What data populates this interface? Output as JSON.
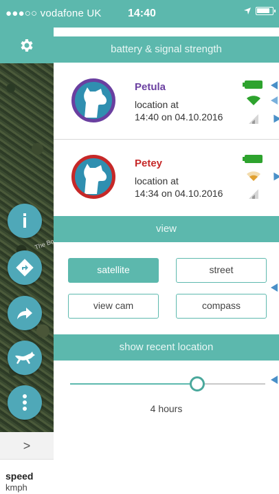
{
  "status_bar": {
    "carrier": "●●●○○ vodafone UK",
    "time": "14:40"
  },
  "sidebar": {
    "map_label": "The Bo",
    "chevron": ">",
    "speed_label": "speed",
    "speed_unit": "kmph",
    "icons": [
      "gear-icon",
      "info-icon",
      "directions-icon",
      "share-arrow-icon",
      "running-dog-icon",
      "more-vert-icon"
    ]
  },
  "battery_section": {
    "title": "battery & signal strength",
    "dogs": [
      {
        "name": "Petula",
        "name_color": "#6a3fa0",
        "ring_color": "#6a3fa0",
        "location_label": "location at",
        "timestamp": "14:40 on 04.10.2016",
        "battery_color": "#2ea32e",
        "wifi_color": "#2ea32e",
        "signal": "weak"
      },
      {
        "name": "Petey",
        "name_color": "#c62828",
        "ring_color": "#c62828",
        "location_label": "location at",
        "timestamp": "14:34 on 04.10.2016",
        "battery_color": "#2ea32e",
        "wifi_color": "#e0a030",
        "signal": "weak"
      }
    ]
  },
  "view_section": {
    "title": "view",
    "buttons": [
      {
        "label": "satellite",
        "active": true
      },
      {
        "label": "street",
        "active": false
      },
      {
        "label": "view cam",
        "active": false
      },
      {
        "label": "compass",
        "active": false
      }
    ]
  },
  "recent_section": {
    "title": "show recent location",
    "slider_fraction": 0.65,
    "value_label": "4 hours"
  },
  "colors": {
    "accent": "#5cb8ad",
    "fab": "#4fa8b8",
    "pointer": "#4a90c8"
  }
}
